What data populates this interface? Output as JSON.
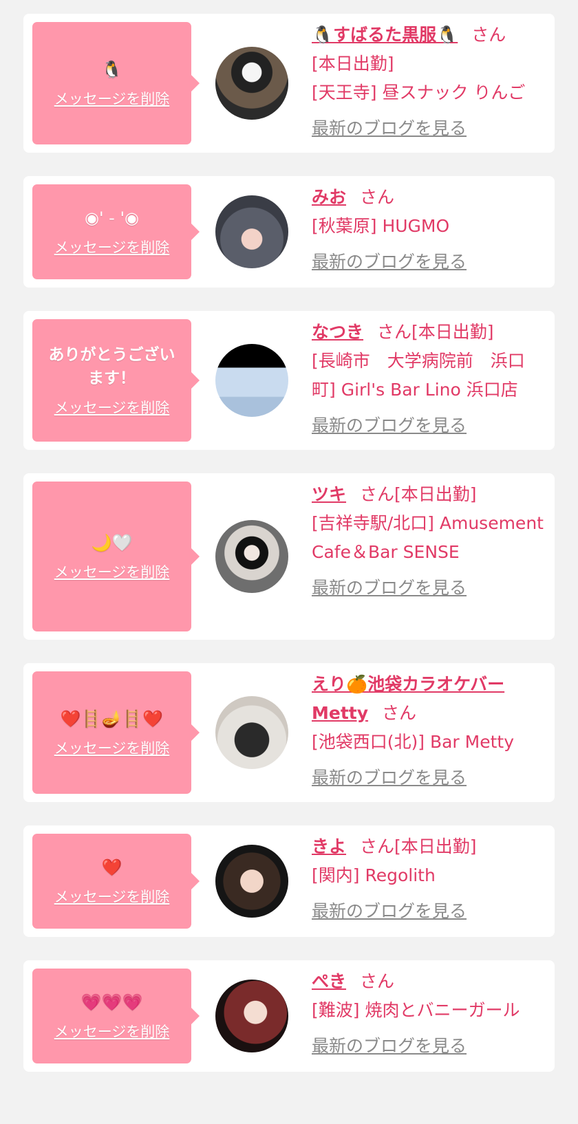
{
  "colors": {
    "accent": "#e13a66",
    "bubble": "#ff97ab",
    "link_gray": "#8a8a8a",
    "background": "#f2f2f2"
  },
  "common": {
    "delete_label": "メッセージを削除",
    "san": "さん",
    "blog_label": "最新のブログを見る"
  },
  "items": [
    {
      "message": "🐧",
      "name": "🐧すばるた黒服🐧",
      "suffix": "",
      "lines": [
        "[本日出勤]",
        "[天王寺] 昼スナック りんご"
      ]
    },
    {
      "message": "◉' - '◉",
      "name": "みお",
      "suffix": "",
      "lines": [
        "[秋葉原] HUGMO"
      ]
    },
    {
      "message": "ありがとうござい\nます！",
      "name": "なつき",
      "suffix": "[本日出勤]",
      "lines": [
        "[長崎市　大学病院前　浜口町] Girl's Bar Lino 浜口店"
      ]
    },
    {
      "message": "🌙🤍",
      "name": "ツキ",
      "suffix": "[本日出勤]",
      "lines": [
        "[吉祥寺駅/北口] Amusement Cafe＆Bar SENSE"
      ]
    },
    {
      "message": "❤️🪜🪔🪜❤️",
      "name": "えり🍊池袋カラオケバーMetty",
      "suffix": "",
      "lines": [
        "[池袋西口(北)] Bar Metty"
      ]
    },
    {
      "message": "❤️",
      "name": "きよ",
      "suffix": "[本日出勤]",
      "lines": [
        "[関内] Regolith"
      ]
    },
    {
      "message": "💗💗💗",
      "name": "ぺき",
      "suffix": "",
      "lines": [
        "[難波] 焼肉とバニーガール"
      ]
    }
  ]
}
